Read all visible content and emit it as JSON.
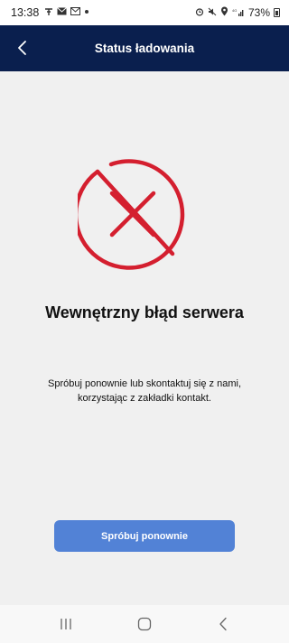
{
  "status_bar": {
    "time": "13:38",
    "battery": "73%",
    "left_icons": [
      "signal-t-icon",
      "mail-icon",
      "gmail-icon",
      "dot-icon"
    ],
    "right_icons": [
      "alarm-icon",
      "mute-icon",
      "location-icon",
      "signal-icon",
      "battery-icon"
    ]
  },
  "app_bar": {
    "title": "Status ładowania",
    "back_icon": "chevron-left-icon"
  },
  "error": {
    "icon": "error-x-circle-icon",
    "title": "Wewnętrzny błąd serwera",
    "message": "Spróbuj ponownie lub skontaktuj się z nami, korzystając z zakładki kontakt."
  },
  "actions": {
    "retry_label": "Spróbuj ponownie"
  },
  "nav_bar": {
    "buttons": [
      "recent-apps-icon",
      "home-icon",
      "back-icon"
    ]
  },
  "colors": {
    "app_bar": "#0a1f4e",
    "error_red": "#d41f2f",
    "button": "#5282d6",
    "background": "#f0f0f0"
  }
}
